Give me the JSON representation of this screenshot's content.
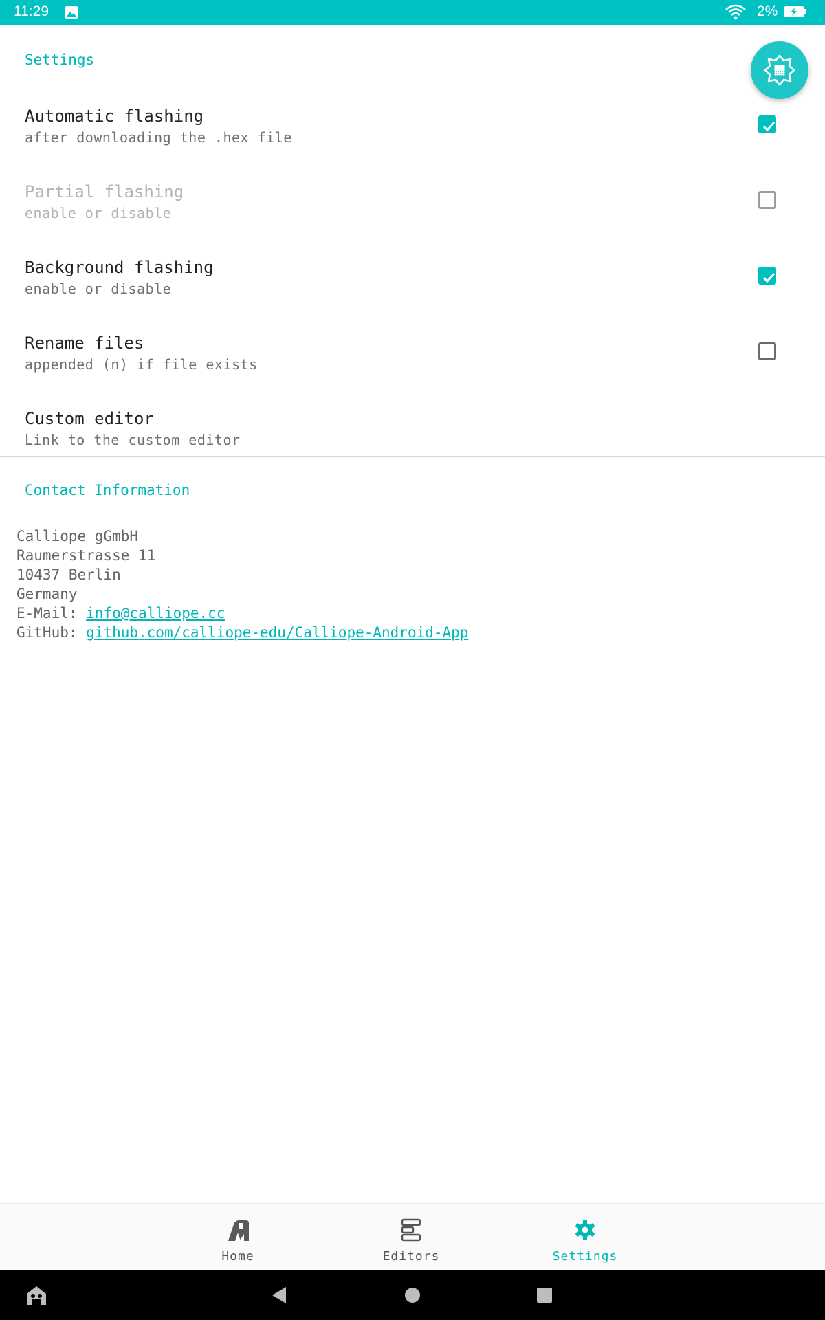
{
  "status_bar": {
    "time": "11:29",
    "battery": "2%"
  },
  "settings": {
    "header": "Settings",
    "items": [
      {
        "title": "Automatic flashing",
        "summary": "after downloading the .hex file",
        "checked": true,
        "enabled": true
      },
      {
        "title": "Partial flashing",
        "summary": "enable or disable",
        "checked": false,
        "enabled": false
      },
      {
        "title": "Background flashing",
        "summary": "enable or disable",
        "checked": true,
        "enabled": true
      },
      {
        "title": "Rename files",
        "summary": "appended (n) if file exists",
        "checked": false,
        "enabled": true
      },
      {
        "title": "Custom editor",
        "summary": "Link to the custom editor"
      }
    ]
  },
  "contact": {
    "header": "Contact Information",
    "lines": [
      "Calliope gGmbH",
      "Raumerstrasse 11",
      "10437 Berlin",
      "Germany"
    ],
    "email_label": "E-Mail: ",
    "email": "info@calliope.cc",
    "github_label": "GitHub: ",
    "github": "github.com/calliope-edu/Calliope-Android-App"
  },
  "bottom_nav": {
    "items": [
      {
        "label": "Home",
        "active": false
      },
      {
        "label": "Editors",
        "active": false
      },
      {
        "label": "Settings",
        "active": true
      }
    ]
  },
  "colors": {
    "accent": "#00bfbf",
    "status_bar": "#00c2c2"
  }
}
